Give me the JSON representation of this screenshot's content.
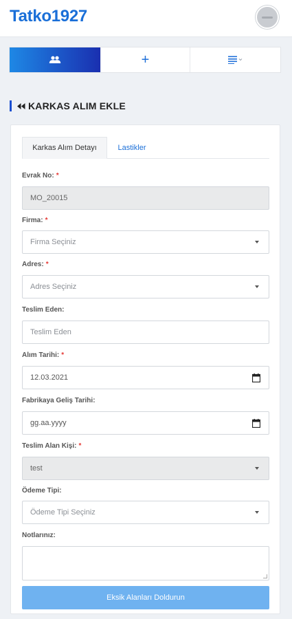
{
  "app": {
    "title": "Tatko1927"
  },
  "nav": {
    "users_icon": "users-icon",
    "add_icon": "plus-icon",
    "add_glyph": "+",
    "menu_icon": "list-menu-icon",
    "accent_gradient": [
      "#1e88e5",
      "#1a2fb0"
    ]
  },
  "section": {
    "title": "KARKAS ALIM EKLE",
    "back_icon": "double-chevron-left-icon"
  },
  "tabs": [
    {
      "label": "Karkas Alım Detayı",
      "active": true
    },
    {
      "label": "Lastikler",
      "active": false
    }
  ],
  "form": {
    "evrak_no": {
      "label": "Evrak No:",
      "required": "*",
      "value": "MO_20015"
    },
    "firma": {
      "label": "Firma:",
      "required": "*",
      "placeholder": "Firma Seçiniz"
    },
    "adres": {
      "label": "Adres:",
      "required": "*",
      "placeholder": "Adres Seçiniz"
    },
    "teslim_eden": {
      "label": "Teslim Eden:",
      "placeholder": "Teslim Eden"
    },
    "alim_tarihi": {
      "label": "Alım Tarihi:",
      "required": "*",
      "value": "12.03.2021"
    },
    "fabrikaya_gelis": {
      "label": "Fabrikaya Geliş Tarihi:",
      "placeholder": "gg.aa.yyyy"
    },
    "teslim_alan": {
      "label": "Teslim Alan Kişi:",
      "required": "*",
      "value": "test"
    },
    "odeme_tipi": {
      "label": "Ödeme Tipi:",
      "placeholder": "Ödeme Tipi Seçiniz"
    },
    "notlar": {
      "label": "Notlarınız:",
      "value": ""
    }
  },
  "submit": {
    "label": "Eksik Alanları Doldurun"
  },
  "colors": {
    "brand": "#1a6fd8",
    "required": "#e53935",
    "submit_bg": "#6fb2f0"
  }
}
